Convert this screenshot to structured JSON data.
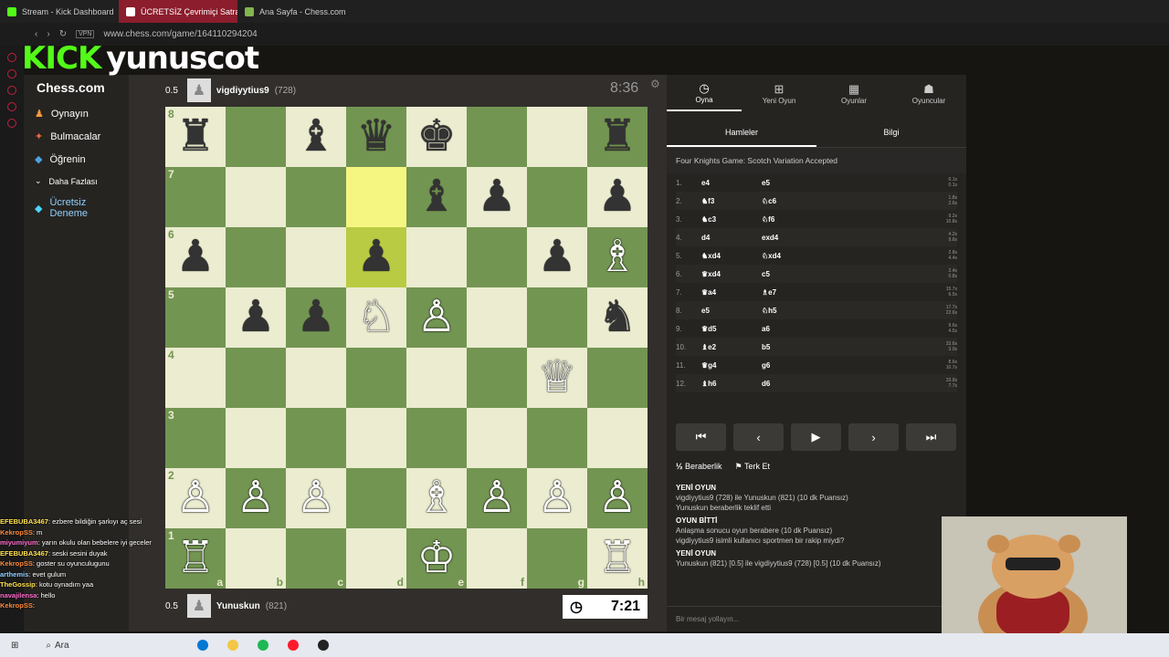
{
  "browser": {
    "tabs": [
      {
        "label": "Stream - Kick Dashboard"
      },
      {
        "label": "ÜCRETSİZ Çevrimiçi Satra"
      },
      {
        "label": "Ana Sayfa - Chess.com"
      }
    ],
    "url": "www.chess.com/game/164110294204",
    "vpn_label": "VPN"
  },
  "overlay": {
    "brand": "KICK",
    "username": "yunuscot"
  },
  "sidebar": {
    "logo": "Chess.com",
    "items": [
      {
        "label": "Oynayın"
      },
      {
        "label": "Bulmacalar"
      },
      {
        "label": "Öğrenin"
      },
      {
        "label": "Daha Fazlası"
      },
      {
        "label": "Ücretsiz Deneme"
      }
    ]
  },
  "top_player": {
    "name": "vigdiyytius9",
    "rating": "(728)",
    "score": "0.5",
    "clock": "8:36"
  },
  "bottom_player": {
    "name": "Yunuskun",
    "rating": "(821)",
    "score": "0.5",
    "clock": "7:21"
  },
  "board": {
    "rows": [
      [
        "♜",
        "",
        "♝",
        "♛",
        "♚",
        "",
        "",
        "♜"
      ],
      [
        "",
        "",
        "",
        "",
        "♝",
        "♟",
        "",
        "♟"
      ],
      [
        "♟",
        "",
        "",
        "♟",
        "",
        "",
        "♟",
        "♗"
      ],
      [
        "",
        "♟",
        "♟",
        "♘",
        "♙",
        "",
        "",
        "♞"
      ],
      [
        "",
        "",
        "",
        "",
        "",
        "",
        "♕",
        ""
      ],
      [
        "",
        "",
        "",
        "",
        "",
        "",
        "",
        ""
      ],
      [
        "♙",
        "♙",
        "♙",
        "",
        "♗",
        "♙",
        "♙",
        "♙"
      ],
      [
        "♖",
        "",
        "",
        "",
        "♔",
        "",
        "",
        "♖"
      ]
    ],
    "colors": [
      [
        "b",
        "",
        "b",
        "b",
        "b",
        "",
        "",
        "b"
      ],
      [
        "",
        "",
        "",
        "",
        "b",
        "b",
        "",
        "b"
      ],
      [
        "b",
        "",
        "",
        "b",
        "",
        "",
        "b",
        "w"
      ],
      [
        "",
        "b",
        "b",
        "w",
        "w",
        "",
        "",
        "b"
      ],
      [
        "",
        "",
        "",
        "",
        "",
        "",
        "w",
        ""
      ],
      [
        "",
        "",
        "",
        "",
        "",
        "",
        "",
        ""
      ],
      [
        "w",
        "w",
        "w",
        "",
        "w",
        "w",
        "w",
        "w"
      ],
      [
        "w",
        "",
        "",
        "",
        "w",
        "",
        "",
        "w"
      ]
    ],
    "ranks": [
      "8",
      "7",
      "6",
      "5",
      "4",
      "3",
      "2",
      "1"
    ],
    "files": [
      "a",
      "b",
      "c",
      "d",
      "e",
      "f",
      "g",
      "h"
    ]
  },
  "panel": {
    "tabs": [
      {
        "label": "Oyna"
      },
      {
        "label": "Yeni Oyun"
      },
      {
        "label": "Oyunlar"
      },
      {
        "label": "Oyuncular"
      }
    ],
    "subtabs": [
      {
        "label": "Hamleler"
      },
      {
        "label": "Bilgi"
      }
    ],
    "opening": "Four Knights Game: Scotch Variation Accepted",
    "moves": [
      {
        "n": "1.",
        "w": "e4",
        "b": "e5",
        "tw": "0.1s",
        "tb": "0.1s"
      },
      {
        "n": "2.",
        "w": "♞f3",
        "b": "♘c6",
        "tw": "1.8s",
        "tb": "2.6s"
      },
      {
        "n": "3.",
        "w": "♞c3",
        "b": "♘f6",
        "tw": "9.2s",
        "tb": "10.8s"
      },
      {
        "n": "4.",
        "w": "d4",
        "b": "exd4",
        "tw": "4.2s",
        "tb": "9.6s"
      },
      {
        "n": "5.",
        "w": "♞xd4",
        "b": "♘xd4",
        "tw": "2.8s",
        "tb": "4.4s"
      },
      {
        "n": "6.",
        "w": "♛xd4",
        "b": "c5",
        "tw": "2.4s",
        "tb": "0.8s"
      },
      {
        "n": "7.",
        "w": "♛a4",
        "b": "♗e7",
        "tw": "15.7s",
        "tb": "6.5s"
      },
      {
        "n": "8.",
        "w": "e5",
        "b": "♘h5",
        "tw": "17.7s",
        "tb": "22.6s"
      },
      {
        "n": "9.",
        "w": "♛d5",
        "b": "a6",
        "tw": "9.6s",
        "tb": "4.5s"
      },
      {
        "n": "10.",
        "w": "♝e2",
        "b": "b5",
        "tw": "33.6s",
        "tb": "3.0s"
      },
      {
        "n": "11.",
        "w": "♛g4",
        "b": "g6",
        "tw": "8.6s",
        "tb": "10.7s"
      },
      {
        "n": "12.",
        "w": "♝h6",
        "b": "d6",
        "tw": "33.9s",
        "tb": "7.7s"
      }
    ],
    "draw_label": "Beraberlik",
    "resign_label": "Terk Et",
    "chat": [
      {
        "head": "YENİ OYUN",
        "text": "vigdiyytius9 (728) ile Yunuskun (821) (10 dk Puansız)"
      },
      {
        "head": "",
        "text": "Yunuskun beraberlik teklif etti"
      },
      {
        "head": "OYUN BİTTİ",
        "text": "Anlaşma sonucu oyun berabere (10 dk Puansız)"
      },
      {
        "head": "",
        "text": "vigdiyytius9 isimli kullanıcı sportmen bir rakip miydi?"
      },
      {
        "head": "YENİ OYUN",
        "text": "Yunuskun (821) [0.5] ile vigdiyytius9 (728) [0.5] (10 dk Puansız)"
      }
    ],
    "message_placeholder": "Bir mesaj yollayın..."
  },
  "stream_chat": [
    {
      "user": "EFEBUBA3467",
      "text": "ezbere bildiğin şarkıyı aç sesi"
    },
    {
      "user": "KekropSS",
      "text": "m"
    },
    {
      "user": "miyumiyum",
      "text": "yarın okulu olan bebelere iyi geceler"
    },
    {
      "user": "EFEBUBA3467",
      "text": "seski sesini duyak"
    },
    {
      "user": "KekropSS",
      "text": "goster su oyunculugunu"
    },
    {
      "user": "arthemis",
      "text": "evet gulum"
    },
    {
      "user": "TheGossip",
      "text": "kotu oynadım yaa"
    },
    {
      "user": "navajilensa",
      "text": "hello"
    },
    {
      "user": "KekropSS",
      "text": ""
    }
  ],
  "taskbar": {
    "search": "Ara"
  }
}
